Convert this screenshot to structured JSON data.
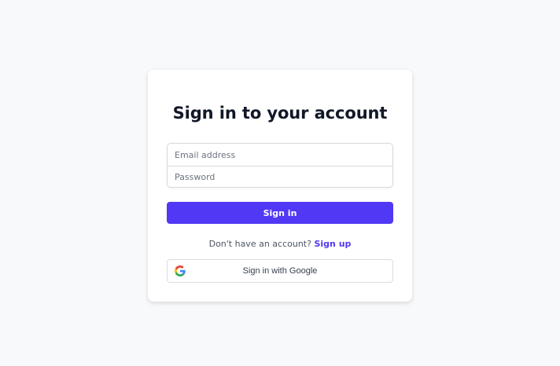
{
  "form": {
    "title": "Sign in to your account",
    "email": {
      "value": "",
      "placeholder": "Email address"
    },
    "password": {
      "value": "",
      "placeholder": "Password"
    },
    "submit_label": "Sign in",
    "signup_prompt": "Don't have an account?",
    "signup_link": "Sign up",
    "google_label": "Sign in with Google"
  },
  "icons": {
    "google": "google-g-icon"
  },
  "colors": {
    "background": "#f8f9fb",
    "primary": "#5038f5",
    "link": "#4f39f0",
    "title": "#111827"
  }
}
